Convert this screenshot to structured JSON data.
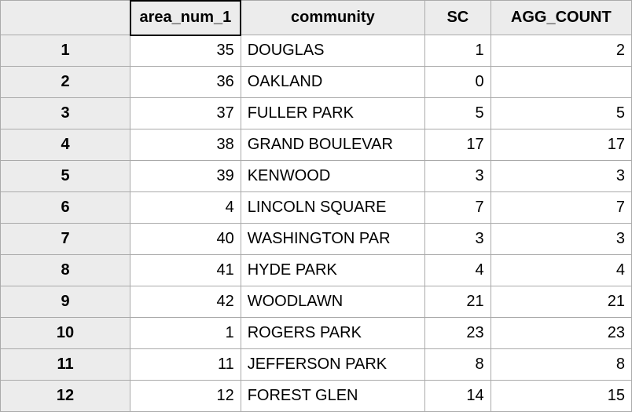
{
  "headers": {
    "row_col": "",
    "area_num_1": "area_num_1",
    "community": "community",
    "sc": "SC",
    "agg_count": "AGG_COUNT"
  },
  "rows": [
    {
      "n": "1",
      "area_num_1": "35",
      "community": "DOUGLAS",
      "sc": "1",
      "agg_count": "2"
    },
    {
      "n": "2",
      "area_num_1": "36",
      "community": "OAKLAND",
      "sc": "0",
      "agg_count": ""
    },
    {
      "n": "3",
      "area_num_1": "37",
      "community": "FULLER PARK",
      "sc": "5",
      "agg_count": "5"
    },
    {
      "n": "4",
      "area_num_1": "38",
      "community": "GRAND BOULEVAR",
      "sc": "17",
      "agg_count": "17"
    },
    {
      "n": "5",
      "area_num_1": "39",
      "community": "KENWOOD",
      "sc": "3",
      "agg_count": "3"
    },
    {
      "n": "6",
      "area_num_1": "4",
      "community": "LINCOLN SQUARE",
      "sc": "7",
      "agg_count": "7"
    },
    {
      "n": "7",
      "area_num_1": "40",
      "community": "WASHINGTON PAR",
      "sc": "3",
      "agg_count": "3"
    },
    {
      "n": "8",
      "area_num_1": "41",
      "community": "HYDE PARK",
      "sc": "4",
      "agg_count": "4"
    },
    {
      "n": "9",
      "area_num_1": "42",
      "community": "WOODLAWN",
      "sc": "21",
      "agg_count": "21"
    },
    {
      "n": "10",
      "area_num_1": "1",
      "community": "ROGERS PARK",
      "sc": "23",
      "agg_count": "23"
    },
    {
      "n": "11",
      "area_num_1": "11",
      "community": "JEFFERSON PARK",
      "sc": "8",
      "agg_count": "8"
    },
    {
      "n": "12",
      "area_num_1": "12",
      "community": "FOREST GLEN",
      "sc": "14",
      "agg_count": "15"
    }
  ]
}
